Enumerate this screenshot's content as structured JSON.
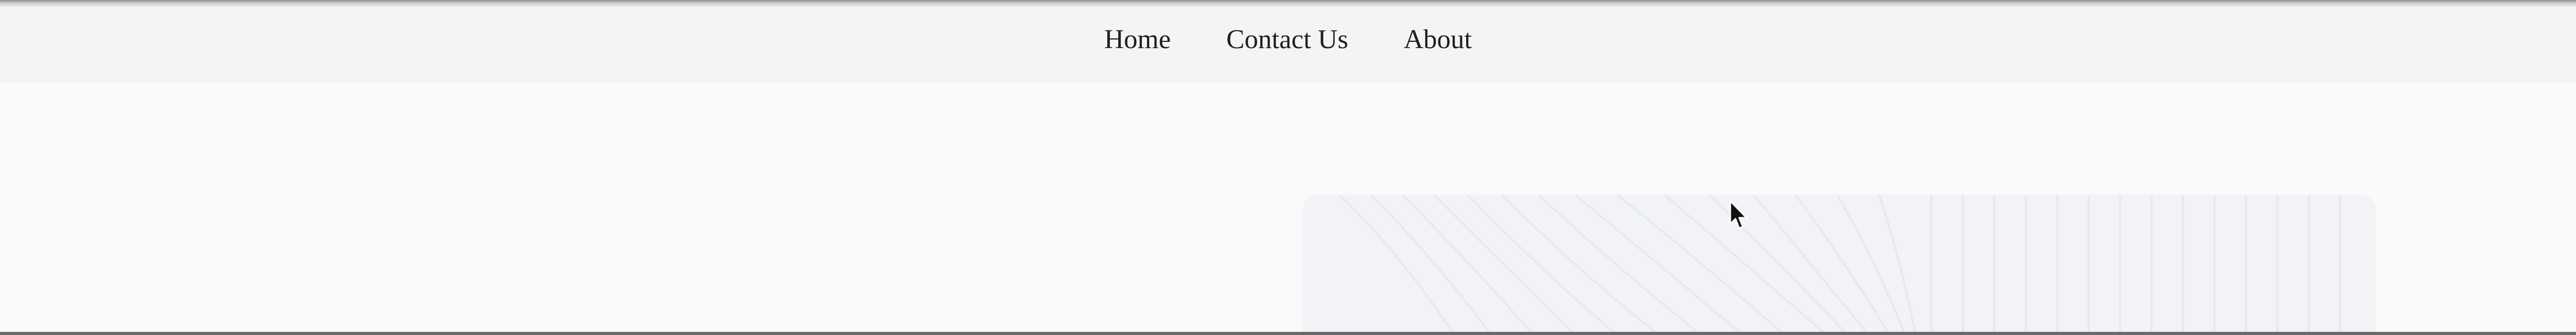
{
  "nav": {
    "items": [
      {
        "label": "Home"
      },
      {
        "label": "Contact Us"
      },
      {
        "label": "About"
      }
    ]
  },
  "colors": {
    "navbar_bg": "#f3f4f6",
    "page_bg": "#fafafa",
    "card_bg": "#f2f3f6",
    "text": "#1f1f1f"
  },
  "icons": {
    "cursor": "mouse-pointer-icon"
  }
}
